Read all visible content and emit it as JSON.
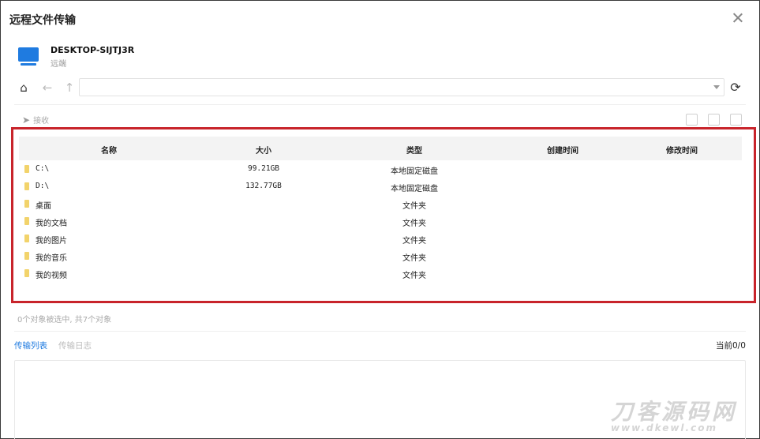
{
  "window": {
    "title": "远程文件传输"
  },
  "device": {
    "name": "DESKTOP-SIJTJ3R",
    "subtitle": "远端"
  },
  "navigation": {
    "path_value": ""
  },
  "toolbar": {
    "send_label": "接收"
  },
  "table": {
    "headers": [
      "名称",
      "大小",
      "类型",
      "创建时间",
      "修改时间"
    ],
    "rows": [
      {
        "name": "C:\\",
        "size": "99.21GB",
        "type": "本地固定磁盘",
        "created": "",
        "modified": ""
      },
      {
        "name": "D:\\",
        "size": "132.77GB",
        "type": "本地固定磁盘",
        "created": "",
        "modified": ""
      },
      {
        "name": "桌面",
        "size": "",
        "type": "文件夹",
        "created": "",
        "modified": ""
      },
      {
        "name": "我的文档",
        "size": "",
        "type": "文件夹",
        "created": "",
        "modified": ""
      },
      {
        "name": "我的图片",
        "size": "",
        "type": "文件夹",
        "created": "",
        "modified": ""
      },
      {
        "name": "我的音乐",
        "size": "",
        "type": "文件夹",
        "created": "",
        "modified": ""
      },
      {
        "name": "我的视频",
        "size": "",
        "type": "文件夹",
        "created": "",
        "modified": ""
      }
    ]
  },
  "status": {
    "text": "0个对象被选中, 共7个对象"
  },
  "transfer": {
    "tabs": [
      {
        "label": "传输列表"
      },
      {
        "label": "传输日志"
      }
    ],
    "current_label": "当前0/0"
  },
  "watermark": {
    "main": "刀客源码网",
    "url": "www.dkewl.com"
  },
  "colors": {
    "accent": "#1f7be0",
    "highlight_border": "#c8242b",
    "folder": "#f2d36b"
  }
}
